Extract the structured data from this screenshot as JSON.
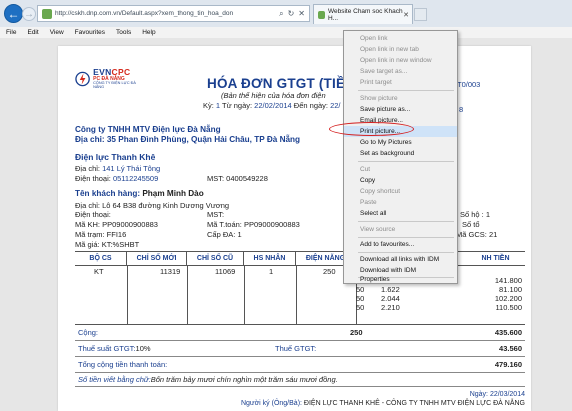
{
  "browser": {
    "url": "http://cskh.dnp.com.vn/Default.aspx?xem_thong_tin_hoa_don",
    "tab_title": "Website Cham soc Khach H...",
    "tab_close": "✕",
    "address_icons": [
      "search-icon",
      "refresh-icon",
      "close-icon"
    ],
    "icon_glyphs": {
      "back": "←",
      "forward": "→",
      "search": "⌕",
      "refresh": "↻",
      "close": "✕"
    }
  },
  "menubar": [
    "File",
    "Edit",
    "View",
    "Favourites",
    "Tools",
    "Help"
  ],
  "invoice": {
    "logo": {
      "evn": "EVN",
      "cpc": "CPC",
      "sub1": "PC ĐÀ NẴNG",
      "sub2": "CÔNG TY ĐIỆN LỰC ĐÀ NẴNG"
    },
    "title": "HÓA ĐƠN GTGT (TIỀN Đ",
    "subtitle": "(Bản thể hiện của hóa đơn điện",
    "meta": {
      "ky_label": "Kỳ: ",
      "ky": "1",
      "tu_ngay_label": "  Từ ngày: ",
      "tu_ngay": "22/02/2014",
      "den_ngay_label": "   Đến ngày: ",
      "den_ngay": "22/"
    },
    "right_fragments": {
      "code": "T0/003",
      "eight": "8"
    },
    "company_name": "Công ty TNHH MTV Điện lực Đà Nẵng",
    "company_address": "Địa chỉ: 35 Phan Đình Phùng, Quận Hải Châu, TP Đà Nẵng",
    "branch": "Điện lực Thanh Khê",
    "branch_address_label": "Địa chỉ: ",
    "branch_address": "141 Lý Thái Tông",
    "branch_phone_label": "Điện thoại: ",
    "branch_phone": "05112245509",
    "mst_label": "MST: ",
    "mst": "0400549228",
    "customer_label": "Tên khách hàng: ",
    "customer_name": "Phạm Minh Dào",
    "customer_address": "Địa chỉ: Lô 64 B38 đường Kinh Dương Vương",
    "customer_phone_label": "Điện thoại:",
    "customer_mst_label": "MST:",
    "ma_kh_label": "Mã KH: ",
    "ma_kh": "PP09000900883",
    "ma_ttoan_label": "Mã T.toán: ",
    "ma_ttoan": "PP09000900883",
    "ma_tram_label": "Mã trạm: ",
    "ma_tram": "FFI16",
    "cap_da_label": "Cấp ĐA: ",
    "cap_da": "1",
    "ma_gia_label": "Mã giá: ",
    "ma_gia": "KT:%SHBT",
    "so_ho_label": "Số hộ : ",
    "so_ho": "1",
    "so_to_label": "Số tổ",
    "ma_gcs_label": "Mã GCS: ",
    "ma_gcs": "21"
  },
  "table": {
    "headers": [
      "BỘ CS",
      "CHỈ SỐ MỚI",
      "CHỈ SỐ CŨ",
      "HS NHÂN",
      "ĐIỆN NĂNG",
      "NH TIỀN"
    ],
    "row": {
      "bo_cs": "KT",
      "chi_so_moi": "11319",
      "chi_so_cu": "11069",
      "hs_nhan": "1",
      "dien_nang": "250"
    },
    "tiers": [
      {
        "kwh": "50",
        "price": "",
        "amount": "141.800"
      },
      {
        "kwh": "50",
        "price": "1.622",
        "amount": "81.100"
      },
      {
        "kwh": "50",
        "price": "2.044",
        "amount": "102.200"
      },
      {
        "kwh": "50",
        "price": "2.210",
        "amount": "110.500"
      }
    ]
  },
  "totals": {
    "cong_label": "Cộng:",
    "cong_kwh": "250",
    "cong_amount": "435.600",
    "vat_rate_label": "Thuế suất GTGT: ",
    "vat_rate": "10%",
    "vat_label": "Thuế GTGT:",
    "vat_amount": "43.560",
    "total_label": "Tổng cộng tiền thanh toán:",
    "total_amount": "479.160",
    "words_label": "Số tiền viết bằng chữ: ",
    "words": "Bốn trăm bảy mươi chín nghìn một trăm sáu mươi đồng."
  },
  "footer": {
    "date_label": "Ngày: ",
    "date": "22/03/2014",
    "signer_label": "Người ký (Ông/Bà): ",
    "signer": "ĐIỆN LỰC THANH KHÊ - CÔNG TY TNHH MTV ĐIỆN LỰC ĐÀ NẴNG"
  },
  "context_menu": {
    "items": [
      {
        "label": "Open link",
        "disabled": true
      },
      {
        "label": "Open link in new tab",
        "disabled": true
      },
      {
        "label": "Open link in new window",
        "disabled": true
      },
      {
        "label": "Save target as...",
        "disabled": true
      },
      {
        "label": "Print target",
        "disabled": true
      },
      {
        "label": "Show picture",
        "disabled": true
      },
      {
        "label": "Save picture as...",
        "disabled": false
      },
      {
        "label": "Email picture...",
        "disabled": false
      },
      {
        "label": "Print picture...",
        "disabled": false,
        "highlighted": true
      },
      {
        "label": "Go to My Pictures",
        "disabled": false
      },
      {
        "label": "Set as background",
        "disabled": false
      },
      {
        "label": "Cut",
        "disabled": true
      },
      {
        "label": "Copy",
        "disabled": false
      },
      {
        "label": "Copy shortcut",
        "disabled": true
      },
      {
        "label": "Paste",
        "disabled": true
      },
      {
        "label": "Select all",
        "disabled": false
      },
      {
        "label": "View source",
        "disabled": true
      },
      {
        "label": "Add to favourites...",
        "disabled": false
      },
      {
        "label": "Download all links with IDM",
        "disabled": false
      },
      {
        "label": "Download with IDM",
        "disabled": false
      },
      {
        "label": "Properties",
        "disabled": false
      }
    ]
  },
  "colors": {
    "brand_blue": "#1a3f8f",
    "evn_red": "#d52b1e",
    "highlight_red": "#d42020",
    "menu_highlight": "#cfe3f8"
  }
}
